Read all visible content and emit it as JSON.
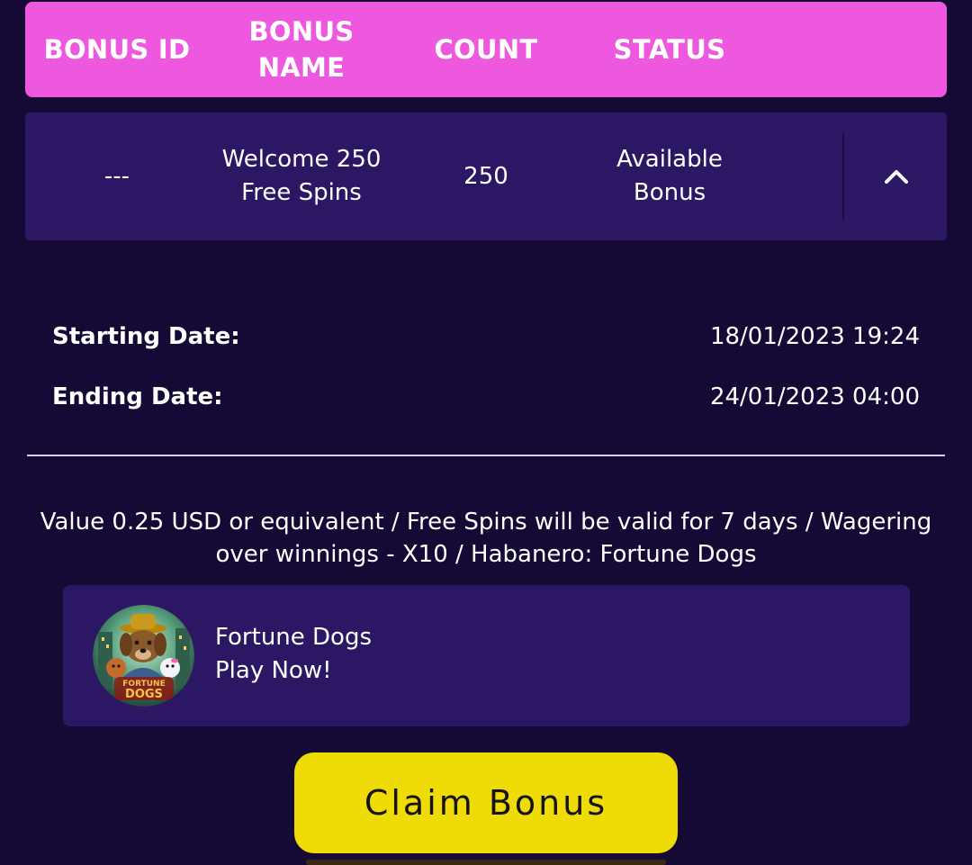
{
  "table": {
    "headers": [
      "BONUS ID",
      "BONUS NAME",
      "COUNT",
      "STATUS"
    ],
    "row": {
      "bonus_id": "---",
      "bonus_name": "Welcome 250 Free Spins",
      "count": "250",
      "status": "Available Bonus"
    }
  },
  "dates": {
    "starting_label": "Starting Date:",
    "starting_value": "18/01/2023 19:24",
    "ending_label": "Ending Date:",
    "ending_value": "24/01/2023 04:00"
  },
  "terms": "Value 0.25 USD or equivalent / Free Spins will be valid for 7 days / Wagering over winnings - X10 / Habanero: Fortune Dogs",
  "game": {
    "name": "Fortune Dogs",
    "cta": "Play Now!",
    "thumbnail_logo_text": "FORTUNE DOGS"
  },
  "claim_button_label": "Claim Bonus",
  "icons": {
    "toggle": "chevron-up-icon",
    "thumbnail": "fortune-dogs-thumbnail"
  },
  "colors": {
    "background": "#140a35",
    "header": "#ee58de",
    "card": "#2c1765",
    "claim_button": "#efdc06"
  }
}
